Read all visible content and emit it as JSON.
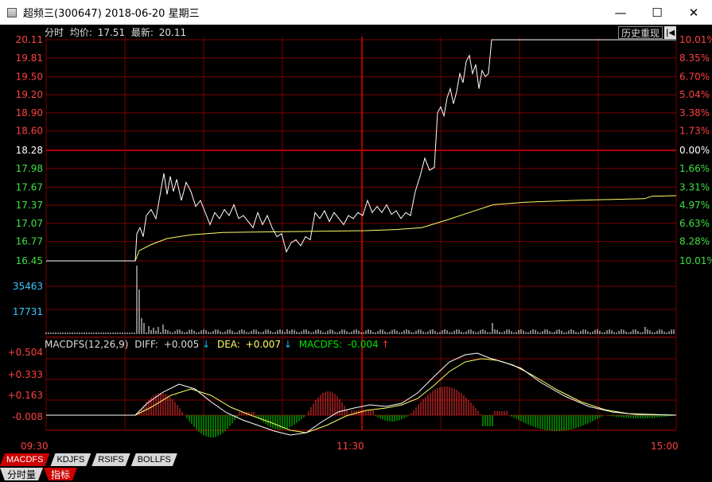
{
  "window": {
    "title": "超频三(300647) 2018-06-20 星期三",
    "minimize": "—",
    "maximize": "☐",
    "close": "✕"
  },
  "header": {
    "label": "分时",
    "avg_label": "均价:",
    "avg_value": "17.51",
    "last_label": "最新:",
    "last_value": "20.11",
    "history_button": "历史重现",
    "history_arrow": "|◀"
  },
  "price_axis": {
    "left": [
      "20.11",
      "19.81",
      "19.50",
      "19.20",
      "18.90",
      "18.60",
      "18.28",
      "17.98",
      "17.67",
      "17.37",
      "17.07",
      "16.77",
      "16.45"
    ],
    "right": [
      "10.01%",
      "8.35%",
      "6.70%",
      "5.04%",
      "3.38%",
      "1.73%",
      "0.00%",
      "1.66%",
      "3.31%",
      "4.97%",
      "6.63%",
      "8.28%",
      "10.01%"
    ]
  },
  "volume_axis": [
    "35463",
    "17731"
  ],
  "macd": {
    "title": "MACDFS(12,26,9)",
    "diff_label": "DIFF:",
    "diff_value": "+0.005",
    "dea_label": "DEA:",
    "dea_value": "+0.007",
    "macd_label": "MACDFS:",
    "macd_value": "-0.004",
    "axis": [
      "+0.504",
      "+0.333",
      "+0.163",
      "-0.008"
    ]
  },
  "time_axis": [
    "09:30",
    "11:30",
    "15:00"
  ],
  "indicator_tabs": [
    "MACDFS",
    "KDJFS",
    "RSIFS",
    "BOLLFS"
  ],
  "bottom_tabs": [
    "分时量",
    "指标"
  ],
  "colors": {
    "up": "#ff3232",
    "down": "#00e600",
    "grid": "#7a0000",
    "price_line": "#ffffff",
    "avg_line": "#ffff66"
  }
}
